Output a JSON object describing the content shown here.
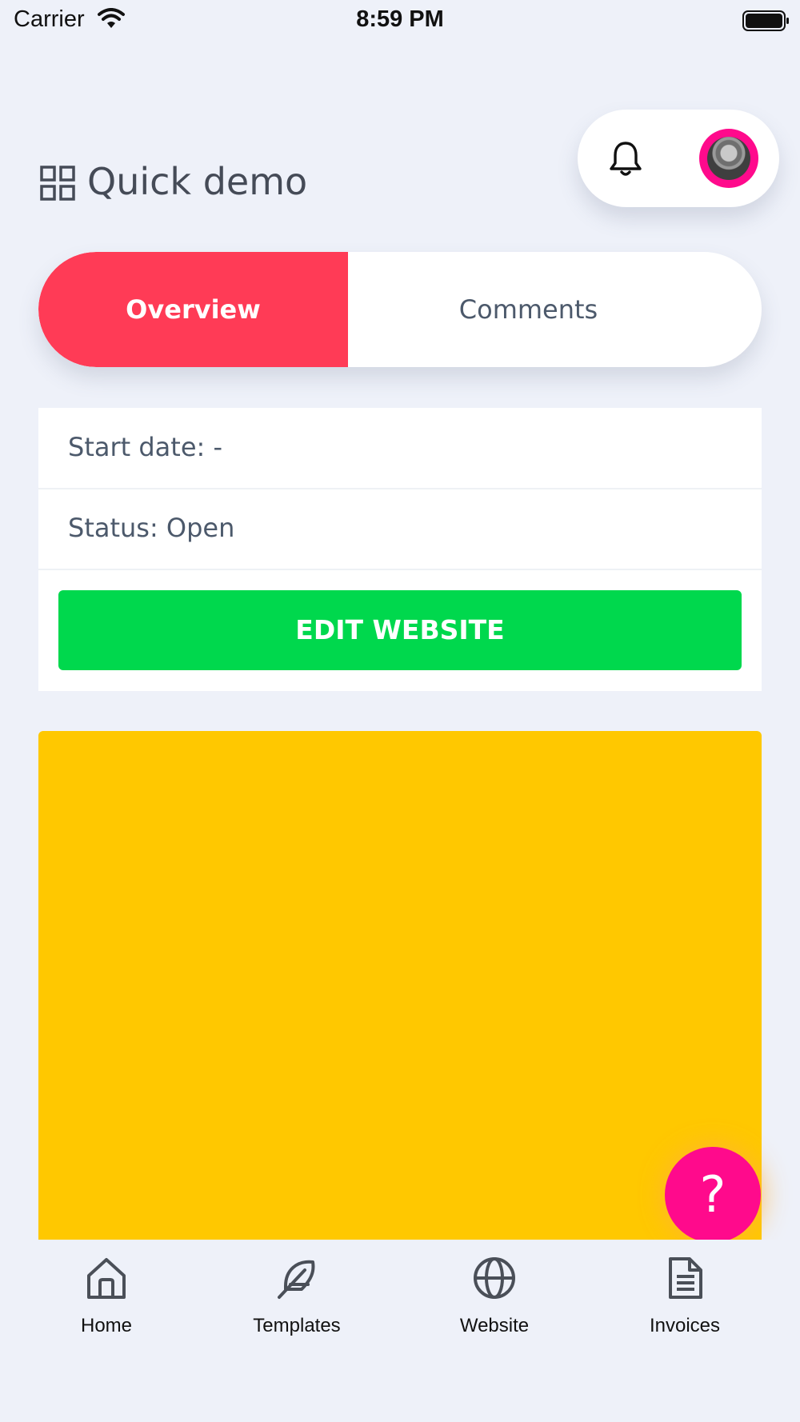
{
  "status_bar": {
    "carrier": "Carrier",
    "time": "8:59 PM"
  },
  "header": {
    "title": "Quick demo",
    "notification_icon": "bell-icon",
    "avatar_icon": "user-avatar"
  },
  "tabs": [
    {
      "label": "Overview",
      "active": true
    },
    {
      "label": "Comments",
      "active": false
    }
  ],
  "details": {
    "start_date": "Start date: -",
    "status": "Status: Open",
    "edit_button": "EDIT WEBSITE"
  },
  "help_button": {
    "label": "?"
  },
  "bottom_nav": [
    {
      "label": "Home",
      "icon": "home-icon"
    },
    {
      "label": "Templates",
      "icon": "feather-icon"
    },
    {
      "label": "Website",
      "icon": "globe-icon"
    },
    {
      "label": "Invoices",
      "icon": "document-icon"
    }
  ],
  "colors": {
    "background": "#eef1f9",
    "active_tab": "#ff3b56",
    "edit_button": "#00d84d",
    "panel": "#ffc800",
    "accent_pink": "#ff0a8c"
  }
}
